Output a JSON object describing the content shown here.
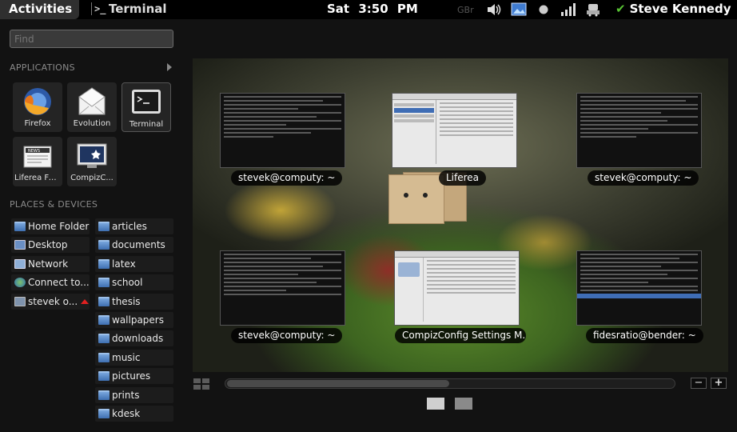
{
  "top_panel": {
    "activities": "Activities",
    "app_menu_icon": ">_",
    "app_menu": "Terminal",
    "clock_day": "Sat",
    "clock_time": "3:50 PM",
    "keyboard_layout": "GBr",
    "tray_icons": [
      "volume-icon",
      "display-icon",
      "power-icon",
      "signal-icon",
      "network-icon"
    ],
    "user_name": "Steve Kennedy"
  },
  "search": {
    "placeholder": "Find"
  },
  "applications": {
    "title": "APPLICATIONS",
    "items": [
      {
        "label": "Firefox",
        "icon": "firefox-icon"
      },
      {
        "label": "Evolution",
        "icon": "evolution-icon"
      },
      {
        "label": "Terminal",
        "icon": "terminal-icon"
      },
      {
        "label": "Liferea Fe...",
        "icon": "liferea-icon"
      },
      {
        "label": "CompizC...",
        "icon": "compizconfig-icon"
      }
    ]
  },
  "places": {
    "title": "PLACES & DEVICES",
    "left": [
      {
        "label": "Home Folder",
        "icon": "home-folder-icon"
      },
      {
        "label": "Desktop",
        "icon": "desktop-icon"
      },
      {
        "label": "Network",
        "icon": "network-icon"
      },
      {
        "label": "Connect to...",
        "icon": "globe-icon"
      },
      {
        "label": "stevek o...",
        "icon": "drive-icon"
      }
    ],
    "right": [
      "articles",
      "documents",
      "latex",
      "school",
      "thesis",
      "wallpapers",
      "downloads",
      "music",
      "pictures",
      "prints",
      "kdesk"
    ]
  },
  "windows": [
    {
      "caption": "stevek@computy: ~",
      "kind": "terminal"
    },
    {
      "caption": "Liferea",
      "kind": "app"
    },
    {
      "caption": "stevek@computy: ~",
      "kind": "terminal"
    },
    {
      "caption": "stevek@computy: ~",
      "kind": "terminal"
    },
    {
      "caption": "CompizConfig Settings M...",
      "kind": "app"
    },
    {
      "caption": "fidesratio@bender: ~",
      "kind": "terminal"
    }
  ],
  "zoom": {
    "out": "−",
    "in": "+"
  },
  "workspaces": {
    "count": 2,
    "active": 1
  },
  "colors": {
    "accent_check": "#58c434",
    "eject": "#e02020",
    "folder": "#4a7bc1"
  }
}
